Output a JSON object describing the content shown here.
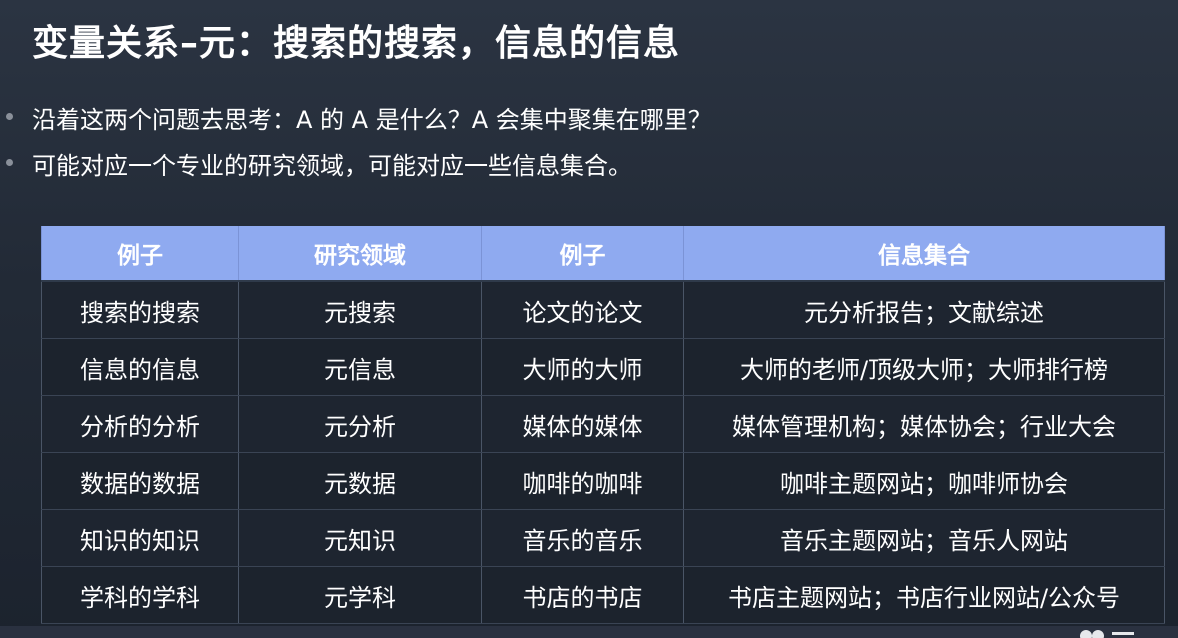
{
  "slide": {
    "title": "变量关系–元：搜索的搜索，信息的信息",
    "bullets": [
      "沿着这两个问题去思考：A 的 A 是什么？A 会集中聚集在哪里？",
      "可能对应一个专业的研究领域，可能对应一些信息集合。"
    ]
  },
  "table": {
    "headers": [
      "例子",
      "研究领域",
      "例子",
      "信息集合"
    ],
    "rows": [
      [
        "搜索的搜索",
        "元搜索",
        "论文的论文",
        "元分析报告；文献综述"
      ],
      [
        "信息的信息",
        "元信息",
        "大师的大师",
        "大师的老师/顶级大师；大师排行榜"
      ],
      [
        "分析的分析",
        "元分析",
        "媒体的媒体",
        "媒体管理机构；媒体协会；行业大会"
      ],
      [
        "数据的数据",
        "元数据",
        "咖啡的咖啡",
        "咖啡主题网站；咖啡师协会"
      ],
      [
        "知识的知识",
        "元知识",
        "音乐的音乐",
        "音乐主题网站；音乐人网站"
      ],
      [
        "学科的学科",
        "元学科",
        "书店的书店",
        "书店主题网站；书店行业网站/公众号"
      ]
    ]
  },
  "colors": {
    "header_bg": "#8faaf0",
    "slide_bg": "#222a36",
    "text": "#ffffff"
  }
}
